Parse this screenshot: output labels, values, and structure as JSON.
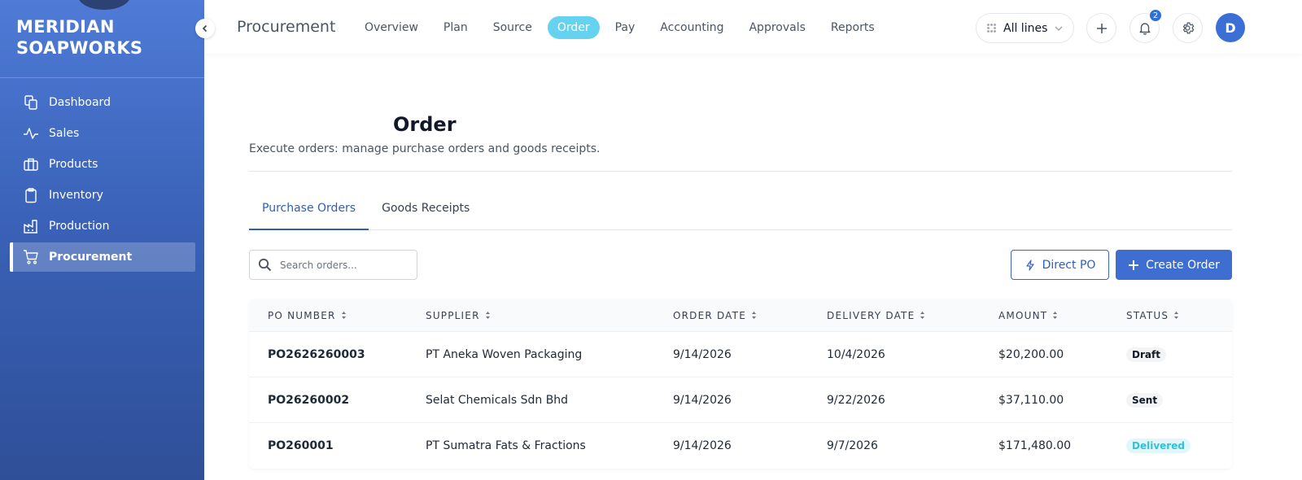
{
  "brand": {
    "line1": "MERIDIAN",
    "line2": "SOAPWORKS"
  },
  "sidebar": {
    "items": [
      {
        "label": "Dashboard",
        "icon": "copy-icon",
        "active": false
      },
      {
        "label": "Sales",
        "icon": "activity-icon",
        "active": false
      },
      {
        "label": "Products",
        "icon": "briefcase-icon",
        "active": false
      },
      {
        "label": "Inventory",
        "icon": "clipboard-icon",
        "active": false
      },
      {
        "label": "Production",
        "icon": "factory-icon",
        "active": false
      },
      {
        "label": "Procurement",
        "icon": "cart-icon",
        "active": true
      }
    ]
  },
  "topbar": {
    "title": "Procurement",
    "nav": [
      {
        "label": "Overview",
        "active": false
      },
      {
        "label": "Plan",
        "active": false
      },
      {
        "label": "Source",
        "active": false
      },
      {
        "label": "Order",
        "active": true
      },
      {
        "label": "Pay",
        "active": false
      },
      {
        "label": "Accounting",
        "active": false
      },
      {
        "label": "Approvals",
        "active": false
      },
      {
        "label": "Reports",
        "active": false
      }
    ],
    "lines_select": "All lines",
    "notification_count": "2",
    "avatar_initial": "D"
  },
  "page": {
    "title": "Order",
    "subtitle": "Execute orders: manage purchase orders and goods receipts."
  },
  "tabs": [
    {
      "label": "Purchase Orders",
      "active": true
    },
    {
      "label": "Goods Receipts",
      "active": false
    }
  ],
  "search": {
    "placeholder": "Search orders...",
    "value": ""
  },
  "actions": {
    "direct_po": "Direct PO",
    "create_order": "Create Order"
  },
  "table": {
    "headers": [
      "PO NUMBER",
      "SUPPLIER",
      "ORDER DATE",
      "DELIVERY DATE",
      "AMOUNT",
      "STATUS"
    ],
    "rows": [
      {
        "po": "PO2626260003",
        "supplier": "PT Aneka Woven Packaging",
        "order_date": "9/14/2026",
        "delivery_date": "10/4/2026",
        "amount": "$20,200.00",
        "status": "Draft"
      },
      {
        "po": "PO26260002",
        "supplier": "Selat Chemicals Sdn Bhd",
        "order_date": "9/14/2026",
        "delivery_date": "9/22/2026",
        "amount": "$37,110.00",
        "status": "Sent"
      },
      {
        "po": "PO260001",
        "supplier": "PT Sumatra Fats & Fractions",
        "order_date": "9/14/2026",
        "delivery_date": "9/7/2026",
        "amount": "$171,480.00",
        "status": "Delivered"
      }
    ]
  },
  "colors": {
    "sidebar_top": "#4f7bd6",
    "sidebar_bottom": "#2f4f98",
    "accent": "#3f6ed1",
    "active_pill": "#65d3f0",
    "delivered": "#38bdd6"
  }
}
